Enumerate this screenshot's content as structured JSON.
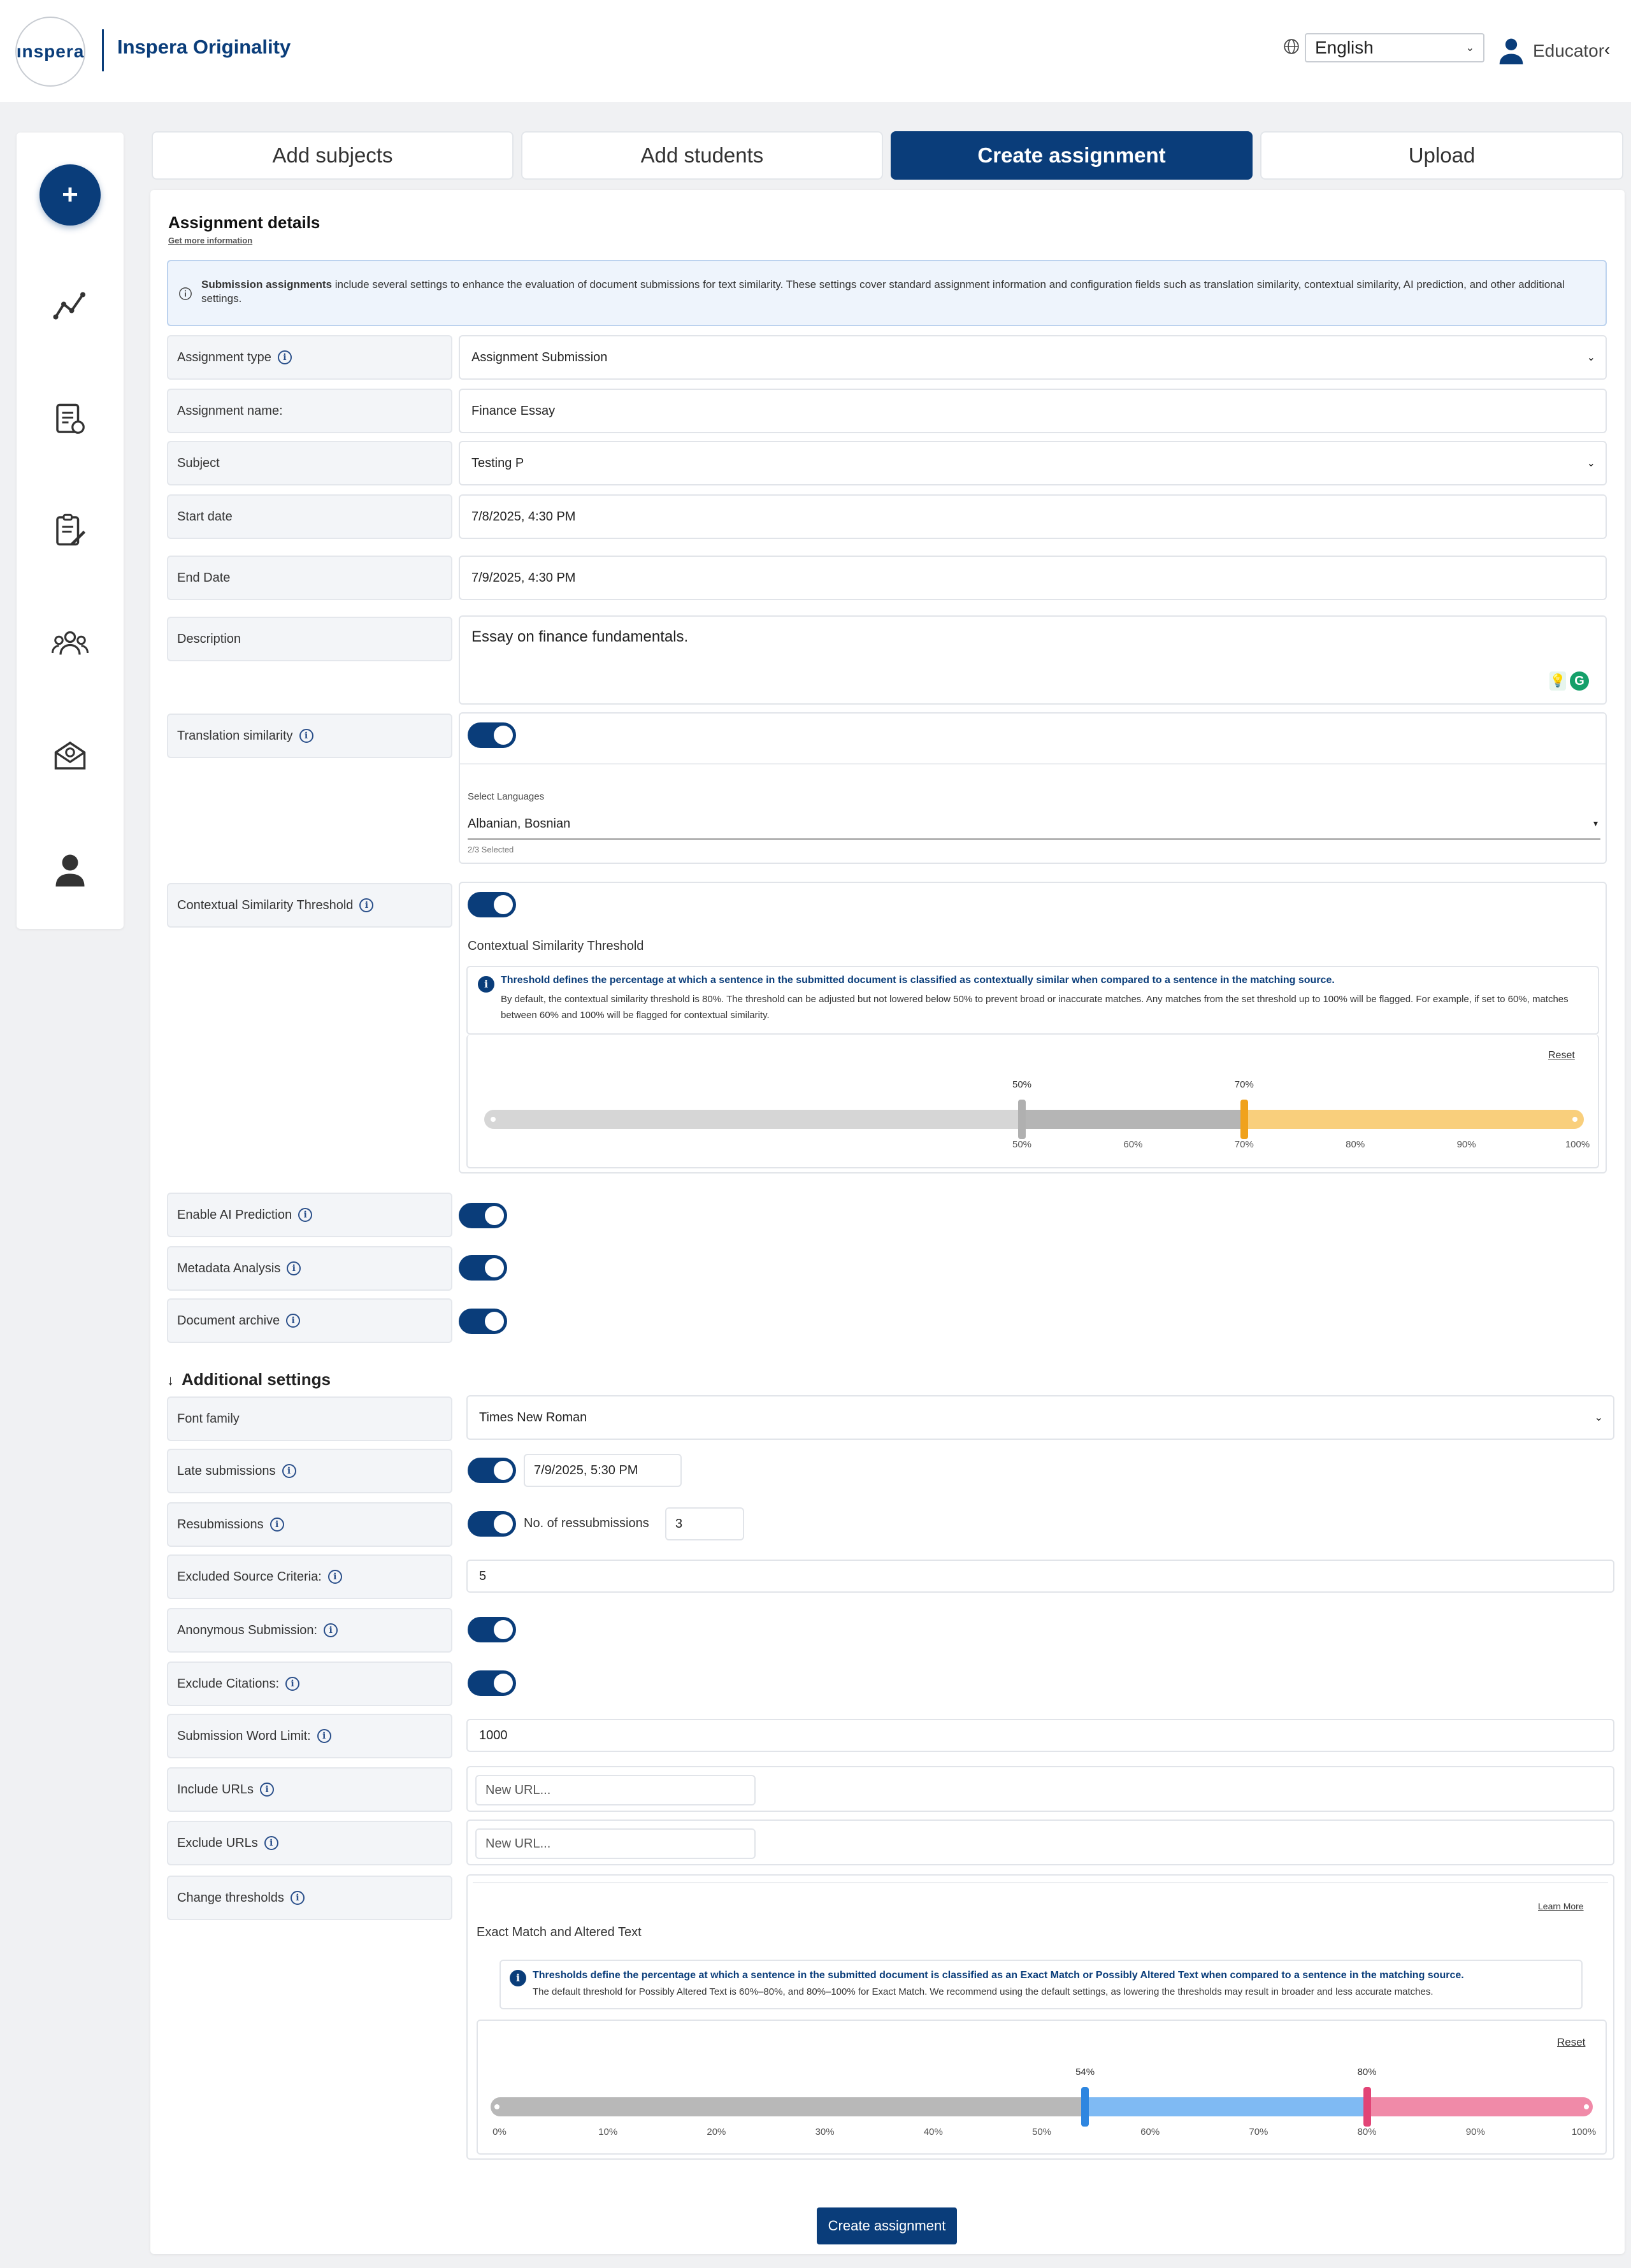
{
  "header": {
    "logo_text": "ınspera",
    "app_title": "Inspera Originality",
    "language": "English",
    "role": "Educator"
  },
  "tabs": [
    {
      "label": "Add subjects"
    },
    {
      "label": "Add students"
    },
    {
      "label": "Create assignment"
    },
    {
      "label": "Upload"
    }
  ],
  "details": {
    "title": "Assignment details",
    "get_more": "Get more information",
    "banner_bold": "Submission assignments",
    "banner_text": " include several settings to enhance the evaluation of document submissions for text similarity. These settings cover standard assignment information and configuration fields such as translation similarity, contextual similarity, AI prediction, and other additional settings.",
    "assignment_type_label": "Assignment type",
    "assignment_type": "Assignment Submission",
    "assignment_name_label": "Assignment name:",
    "assignment_name": "Finance Essay",
    "subject_label": "Subject",
    "subject": "Testing P",
    "start_label": "Start date",
    "start": "7/8/2025, 4:30 PM",
    "end_label": "End Date",
    "end": "7/9/2025, 4:30 PM",
    "desc_label": "Description",
    "desc": "Essay on finance fundamentals.",
    "translation_label": "Translation similarity",
    "select_languages": "Select Languages",
    "languages": "Albanian, Bosnian",
    "languages_count": "2/3 Selected",
    "contextual_label": "Contextual Similarity Threshold",
    "contextual_title": "Contextual Similarity Threshold",
    "contextual_info_bold": "Threshold defines the percentage at which a sentence in the submitted document is classified as contextually similar when compared to a sentence in the matching source.",
    "contextual_info_text": "By default, the contextual similarity threshold is 80%. The threshold can be adjusted but not lowered below 50% to prevent broad or inaccurate matches. Any matches from the set threshold up to 100% will be flagged. For example, if set to 60%, matches between 60% and 100% will be flagged for contextual similarity.",
    "reset": "Reset",
    "ctx_slider": {
      "low": 50,
      "high": 70,
      "low_label": "50%",
      "high_label": "70%",
      "ticks": [
        "50%",
        "60%",
        "70%",
        "80%",
        "90%",
        "100%"
      ]
    },
    "ai_label": "Enable AI Prediction",
    "metadata_label": "Metadata Analysis",
    "archive_label": "Document archive"
  },
  "additional": {
    "title": "Additional settings",
    "font_label": "Font family",
    "font": "Times New Roman",
    "late_label": "Late submissions",
    "late_date": "7/9/2025, 5:30 PM",
    "resub_label": "Resubmissions",
    "resub_text": "No. of ressubmissions",
    "resub_count": "3",
    "excluded_label": "Excluded Source Criteria:",
    "excluded": "5",
    "anon_label": "Anonymous Submission:",
    "citations_label": "Exclude Citations:",
    "wordlimit_label": "Submission Word Limit:",
    "wordlimit": "1000",
    "include_label": "Include URLs",
    "url_placeholder": "New URL...",
    "exclude_label": "Exclude URLs",
    "thresholds_label": "Change thresholds",
    "learn_more": "Learn More",
    "exact_title": "Exact Match and Altered Text",
    "exact_info_bold": "Thresholds define the percentage at which a sentence in the submitted document is classified as an Exact Match or Possibly Altered Text when compared to a sentence in the matching source.",
    "exact_info_text": "The default threshold for Possibly Altered Text is 60%–80%, and 80%–100% for Exact Match. We recommend using the default settings, as lowering the thresholds may result in broader and less accurate matches.",
    "exact_slider": {
      "low": 54,
      "high": 80,
      "low_label": "54%",
      "high_label": "80%",
      "ticks": [
        "0%",
        "10%",
        "20%",
        "30%",
        "40%",
        "50%",
        "60%",
        "70%",
        "80%",
        "90%",
        "100%"
      ]
    },
    "submit": "Create assignment"
  },
  "colors": {
    "primary": "#0a3d7a",
    "orange": "#f0a21c",
    "blue": "#2e86e0",
    "pink": "#e24476"
  }
}
